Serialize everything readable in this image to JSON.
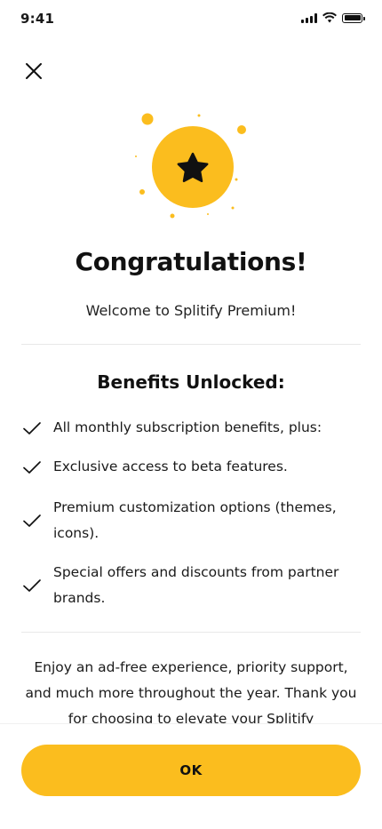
{
  "status_bar": {
    "time": "9:41"
  },
  "header": {
    "close_icon": "close-icon"
  },
  "hero": {
    "icon": "star-icon",
    "accent_color": "#fbbd1e"
  },
  "title": "Congratulations!",
  "subtitle": "Welcome to Splitify Premium!",
  "benefits": {
    "heading": "Benefits Unlocked:",
    "items": [
      {
        "label": "All monthly subscription benefits, plus:"
      },
      {
        "label": "Exclusive access to beta features."
      },
      {
        "label": "Premium customization options (themes, icons)."
      },
      {
        "label": "Special offers and discounts from partner brands."
      }
    ]
  },
  "footer_text": "Enjoy an ad-free experience, priority support, and much more throughout the year. Thank you for choosing to elevate your Splitify",
  "ok_button": {
    "label": "OK"
  }
}
